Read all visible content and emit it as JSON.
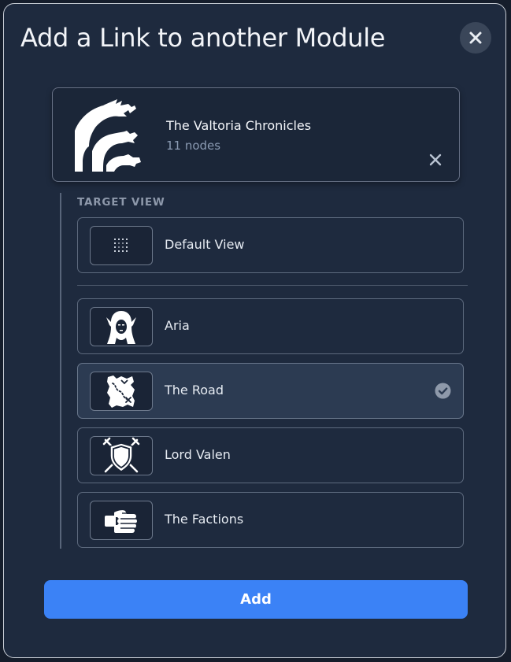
{
  "dialog": {
    "title": "Add a Link to another Module",
    "close_icon": "close-icon"
  },
  "module": {
    "name": "The Valtoria Chronicles",
    "count": "11 nodes",
    "icon": "hydra-icon",
    "remove_icon": "remove-x-icon"
  },
  "target_view": {
    "label": "TARGET VIEW",
    "default": {
      "label": "Default View",
      "icon": "dotted-grid-icon"
    },
    "items": [
      {
        "label": "Aria",
        "icon": "elf-woman-icon",
        "selected": false
      },
      {
        "label": "The Road",
        "icon": "treasure-map-icon",
        "selected": true
      },
      {
        "label": "Lord Valen",
        "icon": "shield-swords-icon",
        "selected": false
      },
      {
        "label": "The Factions",
        "icon": "fist-icon",
        "selected": false
      }
    ]
  },
  "colors": {
    "accent": "#3b82f6",
    "panel": "#1e2a3e",
    "selected": "#2c3b52"
  },
  "actions": {
    "add_label": "Add"
  }
}
